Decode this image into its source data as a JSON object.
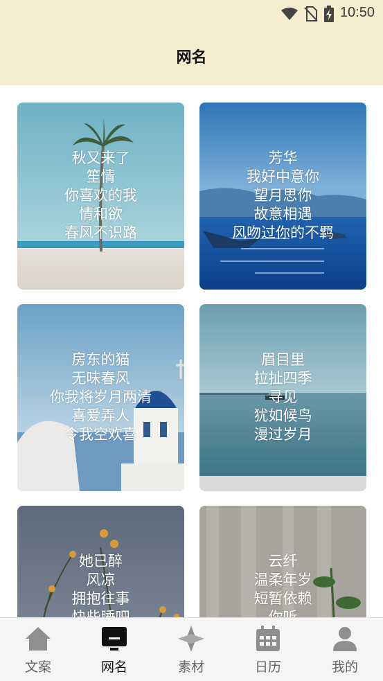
{
  "status_bar": {
    "time": "10:50"
  },
  "header": {
    "title": "网名"
  },
  "cards": [
    {
      "lines": [
        "秋又来了",
        "笙情",
        "你喜欢的我",
        "情和欲",
        "春风不识路"
      ]
    },
    {
      "lines": [
        "芳华",
        "我好中意你",
        "望月思你",
        "故意相遇",
        "风吻过你的不羁"
      ]
    },
    {
      "lines": [
        "房东的猫",
        "无味春风",
        "你我将岁月两清",
        "喜爱弄人",
        "令我空欢喜"
      ]
    },
    {
      "lines": [
        "眉目里",
        "拉扯四季",
        "寻见",
        "犹如候鸟",
        "漫过岁月"
      ]
    },
    {
      "lines": [
        "她已醉",
        "风凉",
        "拥抱往事",
        "快些睡吧"
      ]
    },
    {
      "lines": [
        "云纤",
        "温柔年岁",
        "短暂依赖",
        "你听"
      ]
    }
  ],
  "tabs": [
    {
      "label": "文案",
      "icon": "home-icon",
      "active": false
    },
    {
      "label": "网名",
      "icon": "monitor-icon",
      "active": true
    },
    {
      "label": "素材",
      "icon": "compass-diamond-icon",
      "active": false
    },
    {
      "label": "日历",
      "icon": "calendar-icon",
      "active": false
    },
    {
      "label": "我的",
      "icon": "person-icon",
      "active": false
    }
  ]
}
